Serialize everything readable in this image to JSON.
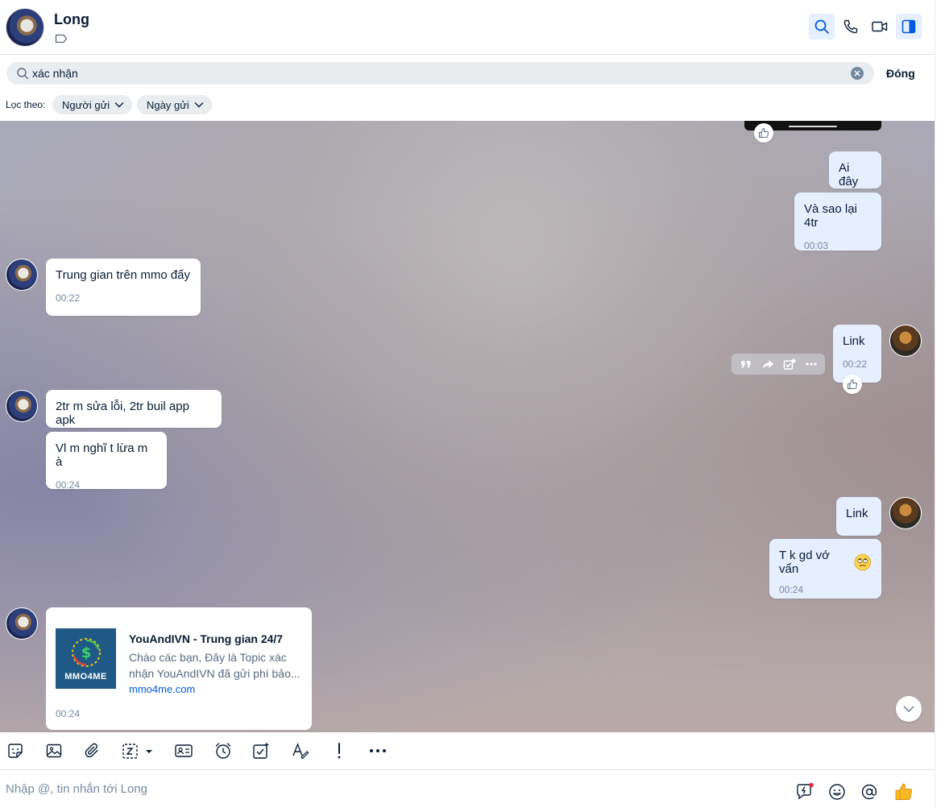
{
  "header": {
    "contact_name": "Long"
  },
  "search": {
    "value": "xác nhận",
    "close_label": "Đóng",
    "filter_label": "Lọc theo:",
    "filters": [
      "Người gửi",
      "Ngày gửi"
    ]
  },
  "messages": {
    "m1": {
      "text": "Ai đây"
    },
    "m2": {
      "text": "Và sao lại 4tr",
      "time": "00:03"
    },
    "m3": {
      "text": "Trung gian trên mmo đấy",
      "time": "00:22"
    },
    "m4": {
      "text": "Link",
      "time": "00:22"
    },
    "m5": {
      "text": "2tr m sửa lỗi, 2tr buil app apk"
    },
    "m6": {
      "text": "Vl m nghĩ t lừa m à",
      "time": "00:24"
    },
    "m7": {
      "text": "Link"
    },
    "m8": {
      "text": "T k gd vớ vẩn",
      "time": "00:24"
    },
    "link_card": {
      "thumb_text": "MMO4ME",
      "title": "YouAndIVN - Trung gian 24/7",
      "description": "Chào các bạn, Đây là Topic xác nhận YouAndIVN đã gửi phí bảo...",
      "domain": "mmo4me.com",
      "time": "00:24"
    }
  },
  "composer": {
    "placeholder": "Nhập @, tin nhắn tới Long"
  },
  "colors": {
    "accent": "#005ae0",
    "outgoing_bubble": "#e5efff",
    "incoming_bubble": "#ffffff"
  },
  "icons": {
    "header": [
      "search-icon",
      "phone-icon",
      "video-call-icon",
      "sidebar-toggle-icon"
    ],
    "toolbar": [
      "sticker-icon",
      "image-icon",
      "attachment-icon",
      "screenshot-icon",
      "contact-card-icon",
      "reminder-icon",
      "task-icon",
      "text-format-icon",
      "urgent-icon",
      "more-icon"
    ],
    "composer": [
      "quick-message-icon",
      "emoji-icon",
      "mention-icon",
      "thumbs-up-icon"
    ]
  }
}
